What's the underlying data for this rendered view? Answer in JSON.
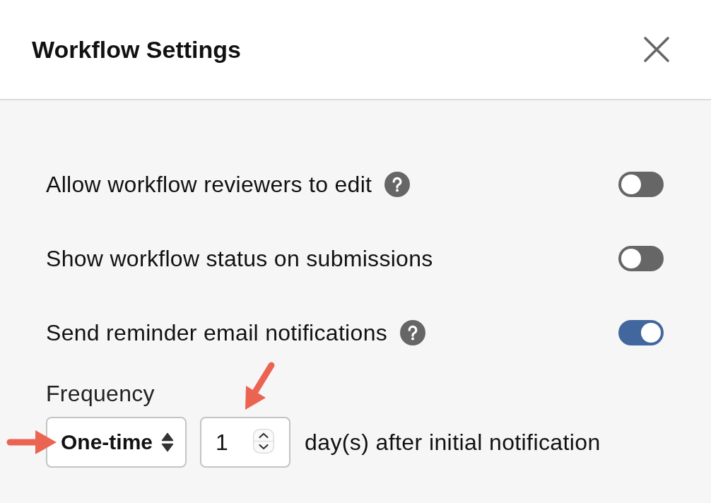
{
  "dialog": {
    "title": "Workflow Settings"
  },
  "settings": [
    {
      "label": "Allow workflow reviewers to edit",
      "help": true,
      "on": false
    },
    {
      "label": "Show workflow status on submissions",
      "help": false,
      "on": false
    },
    {
      "label": "Send reminder email notifications",
      "help": true,
      "on": true
    }
  ],
  "frequency": {
    "label": "Frequency",
    "select": {
      "value": "One-time"
    },
    "days": {
      "value": "1"
    },
    "suffix": "day(s) after initial notification"
  }
}
